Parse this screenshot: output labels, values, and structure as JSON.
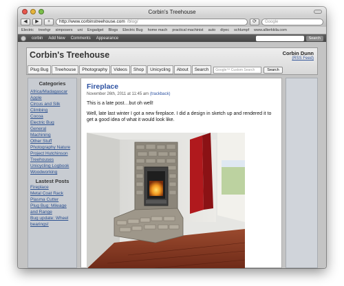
{
  "window": {
    "title": "Corbin's Treehouse"
  },
  "toolbar": {
    "back": "◀",
    "forward": "▶",
    "reload": "⟳",
    "add": "+",
    "url_host": "http://www.corbinstreehouse.com",
    "url_path": "/blog/",
    "search_placeholder": "Google"
  },
  "bookmarks": [
    "Electric",
    "treehgr",
    "simposers",
    "uni",
    "Engadget",
    "Blogs",
    "Electric Bug",
    "home mach",
    "practical machinist",
    "auto",
    "diyec",
    "schlumpf",
    "www.allierkkila.com"
  ],
  "wpbar": {
    "site": "corbin",
    "add_new": "Add New",
    "comments": "Comments",
    "appearance": "Appearance",
    "search": "Search"
  },
  "header": {
    "title": "Corbin's Treehouse",
    "author": "Corbin Dunn",
    "rss": "(RSS Feed)",
    "nav": [
      "Plug Bug",
      "Treehouse",
      "Photography",
      "Videos",
      "Shop",
      "Unicycling",
      "About",
      "Search"
    ],
    "search_placeholder": "Google™ Custom Search",
    "search_button": "Search"
  },
  "sidebar": {
    "categories_title": "Categories",
    "categories": [
      "Africa/Madagascar",
      "Apple",
      "Circus and Silk",
      "Climbing",
      "Cocoa",
      "Electric Bug",
      "General",
      "Machining",
      "Other Stuff",
      "Photography Nature",
      "Project Hutchinson Treehouses",
      "Unicycling Logbook",
      "Woodworking"
    ],
    "latest_title": "Lastest Posts",
    "latest": [
      "Fireplace",
      "Metal Coat Rack",
      "Plasma Cutter",
      "Plug Bug: Mileage and Range",
      "Bug update: Wheel bearings!"
    ]
  },
  "post": {
    "title": "Fireplace",
    "meta": "November 26th, 2011 at 11:45 am",
    "trackback": "(trackback)",
    "p1": "This is a late post…but oh well!",
    "p2": "Well, late last winter I got a new fireplace. I did a design in sketch up and rendered it to get a good idea of what it would look like."
  }
}
